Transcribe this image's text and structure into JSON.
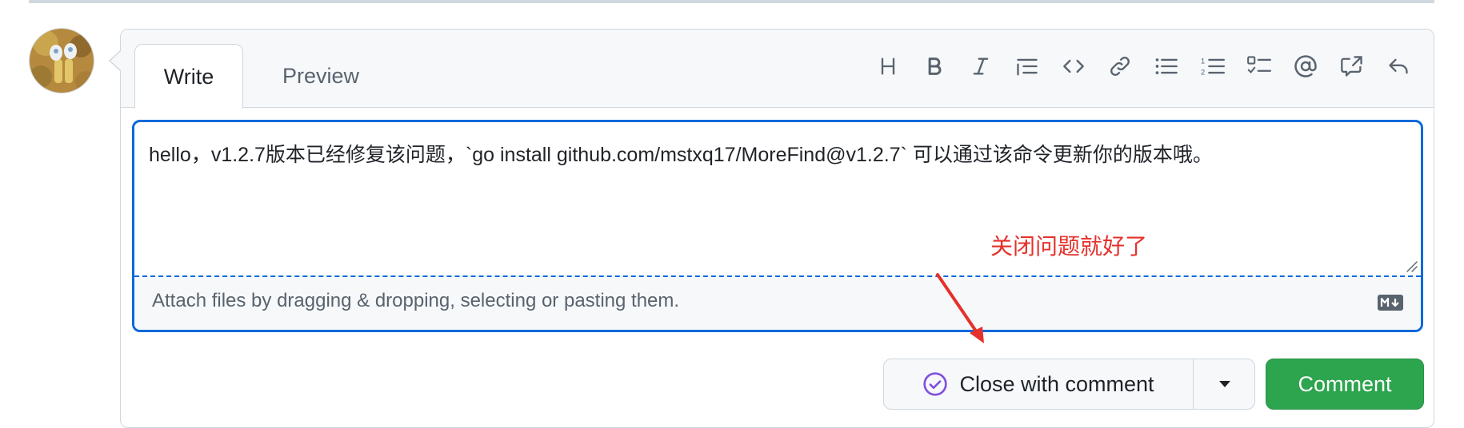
{
  "tabs": {
    "write": "Write",
    "preview": "Preview"
  },
  "toolbar": {
    "icons": [
      "heading-icon",
      "bold-icon",
      "italic-icon",
      "quote-icon",
      "code-icon",
      "link-icon",
      "bulleted-list-icon",
      "numbered-list-icon",
      "task-list-icon",
      "mention-icon",
      "cross-reference-icon",
      "reply-icon"
    ]
  },
  "editor": {
    "text": "hello，v1.2.7版本已经修复该问题，`go install  github.com/mstxq17/MoreFind@v1.2.7` 可以通过该命令更新你的版本哦。",
    "attach_hint": "Attach files by dragging & dropping, selecting or pasting them."
  },
  "annotation": {
    "text": "关闭问题就好了",
    "color": "#e5312b"
  },
  "actions": {
    "close_label": "Close with comment",
    "comment_label": "Comment"
  },
  "colors": {
    "accent": "#0969da",
    "comment_green": "#2da44e",
    "close_icon": "#8250df"
  }
}
